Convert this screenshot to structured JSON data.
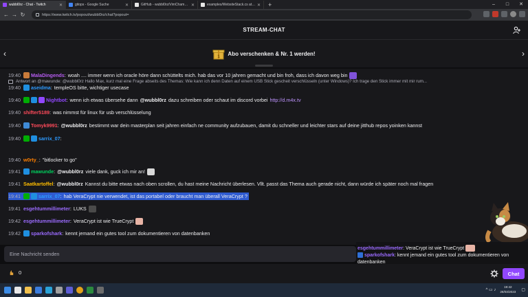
{
  "browser": {
    "tabs": [
      {
        "label": "wubbl0rz - Chat - Twitch",
        "color": "#9147ff",
        "active": true
      },
      {
        "label": "gitops - Google Suche",
        "color": "#4285f4",
        "active": false
      },
      {
        "label": "GitHub - wubbl0rz/VimChamp: S...",
        "color": "#e6e6e6",
        "active": false
      },
      {
        "label": "examples/WebsiteStack.cs at ma...",
        "color": "#e6e6e6",
        "active": false
      }
    ],
    "new_tab": "+",
    "url": "https://www.twitch.tv/popout/wubbl0rz/chat?popout="
  },
  "header": {
    "title": "STREAM-CHAT"
  },
  "promo": {
    "text": "Abo verschenken & Nr. 1 werden!"
  },
  "reply": {
    "text": "Antwort an @mawunde: @wubbl0rz Hallo Max, kurz mal eine Frage abseits des Themas: Wie kann ich denn Daten auf einem USB Stick gescheit verschlüsseln (unter Windows)? Ich trage den Stick immer mit mir rum..."
  },
  "messages": [
    {
      "time": "19:40",
      "user": "MalaDingends",
      "color": "#b65cf0",
      "text": "woah .... immer wenn ich oracle höre dann schüttelts mich. hab das vor 10 jahren gemacht und bin froh, dass ich davon weg bin",
      "badges": [
        "#c97b3a"
      ],
      "emote": "#7f52d9"
    },
    {
      "time": "19:40",
      "user": "aseidma",
      "color": "#2e9bff",
      "text": "templeOS bitte, wichtiger usecase",
      "badges": [
        "#1f8fe0"
      ]
    },
    {
      "time": "19:40",
      "user": "Nightbot",
      "color": "#9147ff",
      "pre": "wenn ich etwas übersehe dann",
      "mention": "@wubbl0rz",
      "post": "dazu schreiben oder schaut im discord vorbei",
      "link": "http://d.m4x.tv",
      "badges": [
        "#00ad03",
        "#1f8fe0",
        "#9147ff"
      ]
    },
    {
      "time": "19:40",
      "user": "shifter5189",
      "color": "#ff4a5a",
      "text": "was nimmst für linux für usb verschlüsselung",
      "badges": []
    },
    {
      "time": "19:40",
      "user": "Tomyk9991",
      "color": "#ff4a5a",
      "mention": "@wubbl0rz",
      "text": "bestimmt war dein masterplan seit jahren einfach ne community aufzubauen, damit du schneller und leichter stars auf deine jitthub repos yoinken kannst",
      "badges": [
        "#3f8ad6"
      ]
    },
    {
      "time": "19:40",
      "user": "sarrix_07",
      "color": "#2e9bff",
      "text": "",
      "badges": [
        "#00ad03",
        "#1f8fe0"
      ]
    },
    {
      "time": "19:40",
      "user": "w0rty_",
      "color": "#ff7f00",
      "text": "\"bitlocker to go\"",
      "badges": []
    },
    {
      "time": "19:41",
      "user": "mawunde",
      "color": "#00d15e",
      "mention": "@wubbl0rz",
      "text": "viele dank, guck ich mir an!",
      "badges": [
        "#1f8fe0"
      ],
      "emote": "#d8d8d8"
    },
    {
      "time": "19:41",
      "user": "Saatkartoffel",
      "color": "#ffbd00",
      "mention": "@wubbl0rz",
      "text": "Kannst du bitte etwas nach oben scrollen, du hast meine Nachricht überlesen. Vllt. passt das Thema auch gerade nicht, dann würde ich später noch mal fragen",
      "badges": []
    },
    {
      "time": "19:41",
      "user": "sarrix_07",
      "color": "#2e9bff",
      "text": "hab VeraCrypt nie verwendet, ist das portabel oder braucht man überall VeraCrypt ?",
      "badges": [
        "#00ad03",
        "#1f8fe0"
      ],
      "highlight": true
    },
    {
      "time": "19:41",
      "user": "esgehtummillimeter",
      "color": "#9b6bff",
      "text": "LUKS",
      "badges": [],
      "emote": "#4a4a4a"
    },
    {
      "time": "19:42",
      "user": "esgehtummillimeter",
      "color": "#9b6bff",
      "text": "VeraCrypt ist wie TrueCrypt",
      "badges": [],
      "emote": "#e8b4a6"
    },
    {
      "time": "19:42",
      "user": "sparkofshark",
      "color": "#9b6bff",
      "text": "kennt jemand ein gutes tool zum dokumentieren von datenbanken",
      "badges": [
        "#1f8fe0"
      ]
    }
  ],
  "overlay": {
    "row1_user": "esgehtummillimeter",
    "row1_text": "VeraCrypt ist wie TrueCrypt",
    "row2_user": "sparkofshark",
    "row2_text": "kennt jemand ein gutes tool zum dokumentieren von datenbanken"
  },
  "input": {
    "placeholder": "Eine Nachricht senden"
  },
  "bottom": {
    "points": "0",
    "chat_button": "Chat"
  },
  "taskbar": {
    "time": "19:42",
    "date": "28/03/2023"
  },
  "colors": {
    "accent": "#9147ff",
    "background": "#18181b",
    "highlight": "#2f5bd0"
  }
}
